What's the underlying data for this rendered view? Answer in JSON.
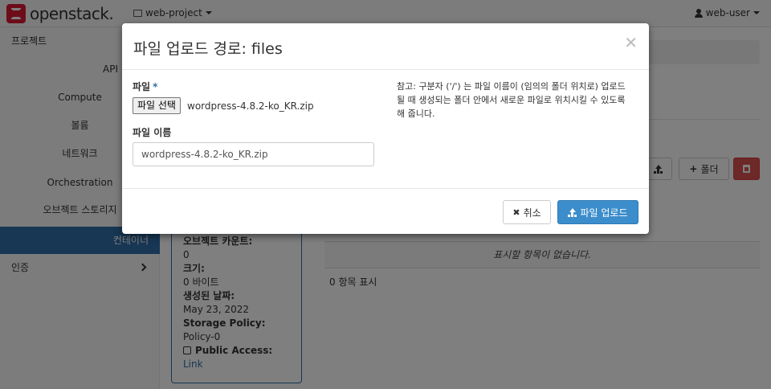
{
  "navbar": {
    "brand": "openstack.",
    "project": "web-project",
    "user": "web-user"
  },
  "sidebar": {
    "items": [
      {
        "label": "프로젝트"
      },
      {
        "label": "API"
      },
      {
        "label": "Compute"
      },
      {
        "label": "볼륨"
      },
      {
        "label": "네트워크"
      },
      {
        "label": "Orchestration"
      },
      {
        "label": "오브젝트 스토리지"
      },
      {
        "label": "컨테이너"
      },
      {
        "label": "인증"
      }
    ]
  },
  "background": {
    "folder_button": "폴더",
    "empty_table": "표시할 항목이 없습니다.",
    "item_count": "0 항목 표시",
    "container_info": {
      "object_count_label": "오브젝트 카운트:",
      "object_count_value": "0",
      "size_label": "크기:",
      "size_value": "0 바이트",
      "created_label": "생성된 날짜:",
      "created_value": "May 23, 2022",
      "policy_label": "Storage Policy:",
      "policy_value": "Policy-0",
      "public_label": "Public Access:",
      "public_link": "Link"
    }
  },
  "modal": {
    "title": "파일 업로드 경로: files",
    "file_label": "파일",
    "required_mark": "*",
    "file_button": "파일 선택",
    "file_chosen": "wordpress-4.8.2-ko_KR.zip",
    "name_label": "파일 이름",
    "name_value": "wordpress-4.8.2-ko_KR.zip",
    "help": "참고: 구분자 ('/') 는 파일 이름이 (임의의 폴더 위치로) 업로드 될 때 생성되는 폴더 안에서 새로운 파일로 위치시킬 수 있도록 해 줍니다.",
    "cancel_button": "취소",
    "upload_button": "파일 업로드"
  },
  "colors": {
    "primary": "#3c8dcb",
    "sidebar_active": "#2f6fa8",
    "danger": "#d9534f",
    "brand_red": "#da1a32"
  }
}
